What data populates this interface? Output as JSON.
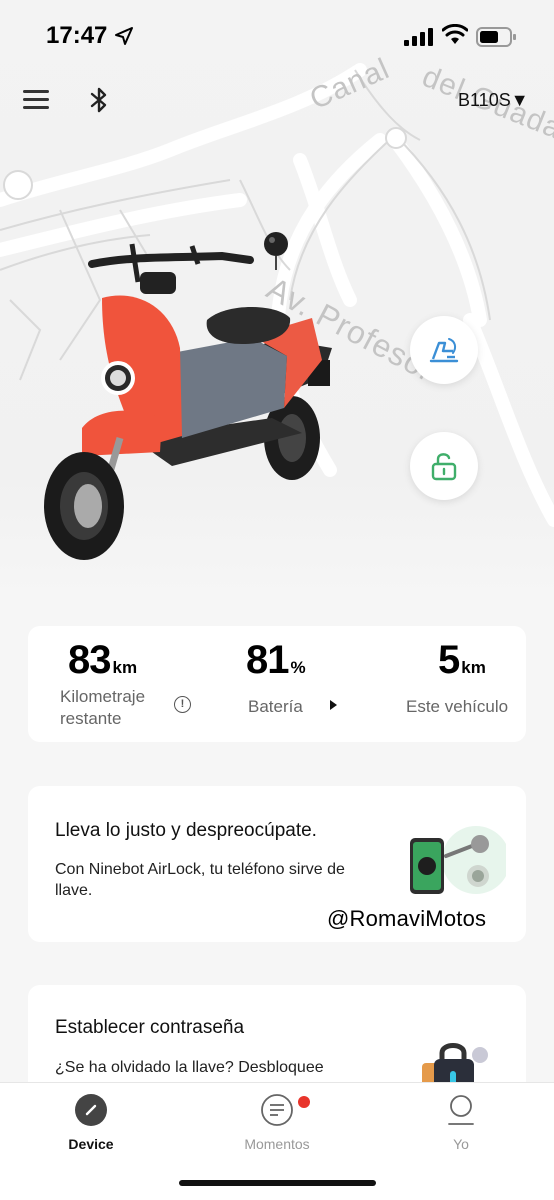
{
  "status_bar": {
    "time": "17:47"
  },
  "header": {
    "model": "B110S▼"
  },
  "map": {
    "street_1": "Canal",
    "street_2": "del Guadalm",
    "street_3": "Av. Profesor"
  },
  "stats": {
    "range": {
      "value": "83",
      "unit": "km",
      "label": "Kilometraje restante"
    },
    "battery": {
      "value": "81",
      "unit": "%",
      "label": "Batería"
    },
    "vehicle": {
      "value": "5",
      "unit": "km",
      "label": "Este vehículo"
    }
  },
  "airlock_card": {
    "title": "Lleva lo justo y despreocúpate.",
    "text": "Con Ninebot AirLock, tu teléfono sirve de llave."
  },
  "password_card": {
    "title": "Establecer contraseña",
    "text": "¿Se ha olvidado la llave? Desbloquee"
  },
  "watermark": "@RomaviMotos",
  "tabs": [
    {
      "label": "Device"
    },
    {
      "label": "Momentos"
    },
    {
      "label": "Yo"
    }
  ],
  "colors": {
    "accent_red": "#e8342b",
    "scooter_red": "#f0543c",
    "lock_green": "#3fae6a",
    "find_blue": "#3b8fd6"
  }
}
